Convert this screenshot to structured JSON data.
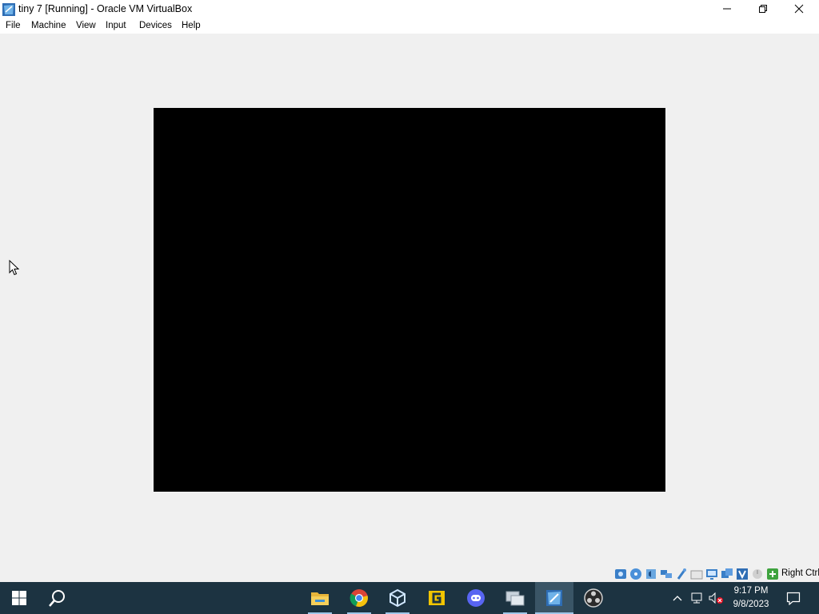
{
  "window": {
    "title": "tiny 7 [Running] - Oracle VM VirtualBox",
    "controls": {
      "minimize": "minimize-icon",
      "restore": "restore-icon",
      "close": "close-icon"
    }
  },
  "menu": {
    "items": [
      {
        "label": "File"
      },
      {
        "label": "Machine"
      },
      {
        "label": "View"
      },
      {
        "label": "Input"
      },
      {
        "label": "Devices"
      },
      {
        "label": "Help"
      }
    ]
  },
  "status_bar": {
    "icons": [
      "hard-disk-icon",
      "optical-drive-icon",
      "audio-icon",
      "network-icon",
      "usb-icon",
      "shared-folders-icon",
      "display-icon",
      "recording-icon",
      "virtualization-icon",
      "mouse-integration-icon",
      "keyboard-capture-icon"
    ],
    "host_key": "Right Ctrl"
  },
  "taskbar": {
    "pinned": [
      "file-explorer-icon",
      "chrome-icon",
      "virtualbox-icon",
      "g-app-icon",
      "discord-icon",
      "network-app-icon",
      "virtualbox-vm-icon",
      "obs-icon"
    ],
    "active_index": 6,
    "clock": {
      "time": "9:17 PM",
      "date": "9/8/2023"
    },
    "colors": {
      "taskbar": "#1c3341",
      "active": "#3a5566",
      "underline": "#9fc6e8"
    }
  }
}
